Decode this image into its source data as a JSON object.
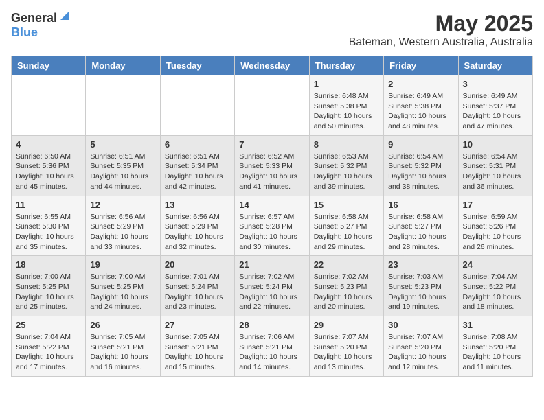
{
  "header": {
    "logo_general": "General",
    "logo_blue": "Blue",
    "title": "May 2025",
    "subtitle": "Bateman, Western Australia, Australia"
  },
  "calendar": {
    "days_of_week": [
      "Sunday",
      "Monday",
      "Tuesday",
      "Wednesday",
      "Thursday",
      "Friday",
      "Saturday"
    ],
    "weeks": [
      [
        {
          "day": "",
          "content": ""
        },
        {
          "day": "",
          "content": ""
        },
        {
          "day": "",
          "content": ""
        },
        {
          "day": "",
          "content": ""
        },
        {
          "day": "1",
          "content": "Sunrise: 6:48 AM\nSunset: 5:38 PM\nDaylight: 10 hours and 50 minutes."
        },
        {
          "day": "2",
          "content": "Sunrise: 6:49 AM\nSunset: 5:38 PM\nDaylight: 10 hours and 48 minutes."
        },
        {
          "day": "3",
          "content": "Sunrise: 6:49 AM\nSunset: 5:37 PM\nDaylight: 10 hours and 47 minutes."
        }
      ],
      [
        {
          "day": "4",
          "content": "Sunrise: 6:50 AM\nSunset: 5:36 PM\nDaylight: 10 hours and 45 minutes."
        },
        {
          "day": "5",
          "content": "Sunrise: 6:51 AM\nSunset: 5:35 PM\nDaylight: 10 hours and 44 minutes."
        },
        {
          "day": "6",
          "content": "Sunrise: 6:51 AM\nSunset: 5:34 PM\nDaylight: 10 hours and 42 minutes."
        },
        {
          "day": "7",
          "content": "Sunrise: 6:52 AM\nSunset: 5:33 PM\nDaylight: 10 hours and 41 minutes."
        },
        {
          "day": "8",
          "content": "Sunrise: 6:53 AM\nSunset: 5:32 PM\nDaylight: 10 hours and 39 minutes."
        },
        {
          "day": "9",
          "content": "Sunrise: 6:54 AM\nSunset: 5:32 PM\nDaylight: 10 hours and 38 minutes."
        },
        {
          "day": "10",
          "content": "Sunrise: 6:54 AM\nSunset: 5:31 PM\nDaylight: 10 hours and 36 minutes."
        }
      ],
      [
        {
          "day": "11",
          "content": "Sunrise: 6:55 AM\nSunset: 5:30 PM\nDaylight: 10 hours and 35 minutes."
        },
        {
          "day": "12",
          "content": "Sunrise: 6:56 AM\nSunset: 5:29 PM\nDaylight: 10 hours and 33 minutes."
        },
        {
          "day": "13",
          "content": "Sunrise: 6:56 AM\nSunset: 5:29 PM\nDaylight: 10 hours and 32 minutes."
        },
        {
          "day": "14",
          "content": "Sunrise: 6:57 AM\nSunset: 5:28 PM\nDaylight: 10 hours and 30 minutes."
        },
        {
          "day": "15",
          "content": "Sunrise: 6:58 AM\nSunset: 5:27 PM\nDaylight: 10 hours and 29 minutes."
        },
        {
          "day": "16",
          "content": "Sunrise: 6:58 AM\nSunset: 5:27 PM\nDaylight: 10 hours and 28 minutes."
        },
        {
          "day": "17",
          "content": "Sunrise: 6:59 AM\nSunset: 5:26 PM\nDaylight: 10 hours and 26 minutes."
        }
      ],
      [
        {
          "day": "18",
          "content": "Sunrise: 7:00 AM\nSunset: 5:25 PM\nDaylight: 10 hours and 25 minutes."
        },
        {
          "day": "19",
          "content": "Sunrise: 7:00 AM\nSunset: 5:25 PM\nDaylight: 10 hours and 24 minutes."
        },
        {
          "day": "20",
          "content": "Sunrise: 7:01 AM\nSunset: 5:24 PM\nDaylight: 10 hours and 23 minutes."
        },
        {
          "day": "21",
          "content": "Sunrise: 7:02 AM\nSunset: 5:24 PM\nDaylight: 10 hours and 22 minutes."
        },
        {
          "day": "22",
          "content": "Sunrise: 7:02 AM\nSunset: 5:23 PM\nDaylight: 10 hours and 20 minutes."
        },
        {
          "day": "23",
          "content": "Sunrise: 7:03 AM\nSunset: 5:23 PM\nDaylight: 10 hours and 19 minutes."
        },
        {
          "day": "24",
          "content": "Sunrise: 7:04 AM\nSunset: 5:22 PM\nDaylight: 10 hours and 18 minutes."
        }
      ],
      [
        {
          "day": "25",
          "content": "Sunrise: 7:04 AM\nSunset: 5:22 PM\nDaylight: 10 hours and 17 minutes."
        },
        {
          "day": "26",
          "content": "Sunrise: 7:05 AM\nSunset: 5:21 PM\nDaylight: 10 hours and 16 minutes."
        },
        {
          "day": "27",
          "content": "Sunrise: 7:05 AM\nSunset: 5:21 PM\nDaylight: 10 hours and 15 minutes."
        },
        {
          "day": "28",
          "content": "Sunrise: 7:06 AM\nSunset: 5:21 PM\nDaylight: 10 hours and 14 minutes."
        },
        {
          "day": "29",
          "content": "Sunrise: 7:07 AM\nSunset: 5:20 PM\nDaylight: 10 hours and 13 minutes."
        },
        {
          "day": "30",
          "content": "Sunrise: 7:07 AM\nSunset: 5:20 PM\nDaylight: 10 hours and 12 minutes."
        },
        {
          "day": "31",
          "content": "Sunrise: 7:08 AM\nSunset: 5:20 PM\nDaylight: 10 hours and 11 minutes."
        }
      ]
    ]
  }
}
